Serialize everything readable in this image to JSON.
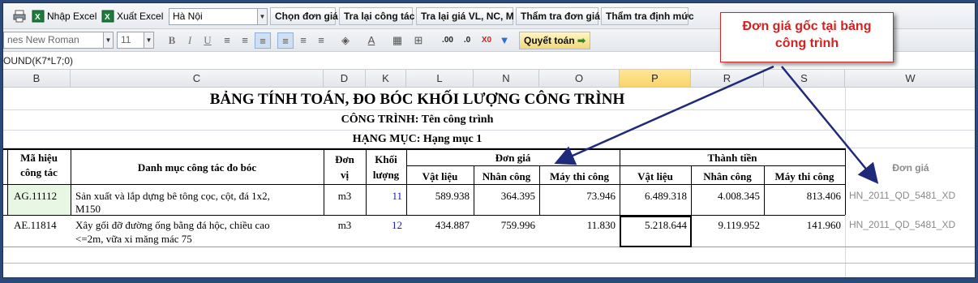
{
  "toolbar": {
    "import_excel": "Nhập Excel",
    "export_excel": "Xuất Excel",
    "region_value": "Hà Nội",
    "choose_price": "Chọn đơn giá",
    "lookup_work": "Tra lại công tác",
    "lookup_price": "Tra lại giá VL, NC, M",
    "check_price": "Thẩm tra đơn giá",
    "check_norm": "Thẩm tra định mức",
    "font_name": "nes New Roman",
    "font_size": "11",
    "settle_button": "Quyết toán"
  },
  "formula_bar": {
    "text": "OUND(K7*L7;0)"
  },
  "columns": [
    "B",
    "C",
    "D",
    "K",
    "L",
    "N",
    "O",
    "P",
    "R",
    "S",
    "W"
  ],
  "selected_column": "P",
  "sheet": {
    "title": "BẢNG TÍNH TOÁN, ĐO BÓC KHỐI LƯỢNG CÔNG TRÌNH",
    "project": "CÔNG TRÌNH: Tên công trình",
    "item": "HẠNG MỤC: Hạng mục 1",
    "headers": {
      "code": [
        "Mã hiệu",
        "công tác"
      ],
      "desc": "Danh mục công tác đo bóc",
      "unit": [
        "Đơn",
        "vị"
      ],
      "qty": [
        "Khối",
        "lượng"
      ],
      "unit_price": "Đơn giá",
      "amount": "Thành tiền",
      "material": "Vật liệu",
      "labor": "Nhân công",
      "machine": "Máy thi công",
      "price_source": "Đơn giá"
    },
    "rows": [
      {
        "code": "AG.11112",
        "desc": [
          "Sản xuất và lắp dựng bê tông cọc, cột, đá 1x2,",
          "M150"
        ],
        "unit": "m3",
        "qty": "11",
        "price_material": "589.938",
        "price_labor": "364.395",
        "price_machine": "73.946",
        "amt_material": "6.489.318",
        "amt_labor": "4.008.345",
        "amt_machine": "813.406",
        "source": "HN_2011_QD_5481_XD"
      },
      {
        "code": "AE.11814",
        "desc": [
          "Xây gối đỡ đường ống bằng đá hộc, chiều cao",
          "<=2m, vữa xi măng mác 75"
        ],
        "unit": "m3",
        "qty": "12",
        "price_material": "434.887",
        "price_labor": "759.996",
        "price_machine": "11.830",
        "amt_material": "5.218.644",
        "amt_labor": "9.119.952",
        "amt_machine": "141.960",
        "source": "HN_2011_QD_5481_XD"
      }
    ]
  },
  "callout": {
    "line1": "Đơn giá gốc tại bảng",
    "line2": "công trình"
  },
  "colors": {
    "callout_text": "#d91f1f",
    "arrow": "#1f2a7a",
    "selected_col": "#f9d46a",
    "qty_blue": "#1a1ab8"
  }
}
